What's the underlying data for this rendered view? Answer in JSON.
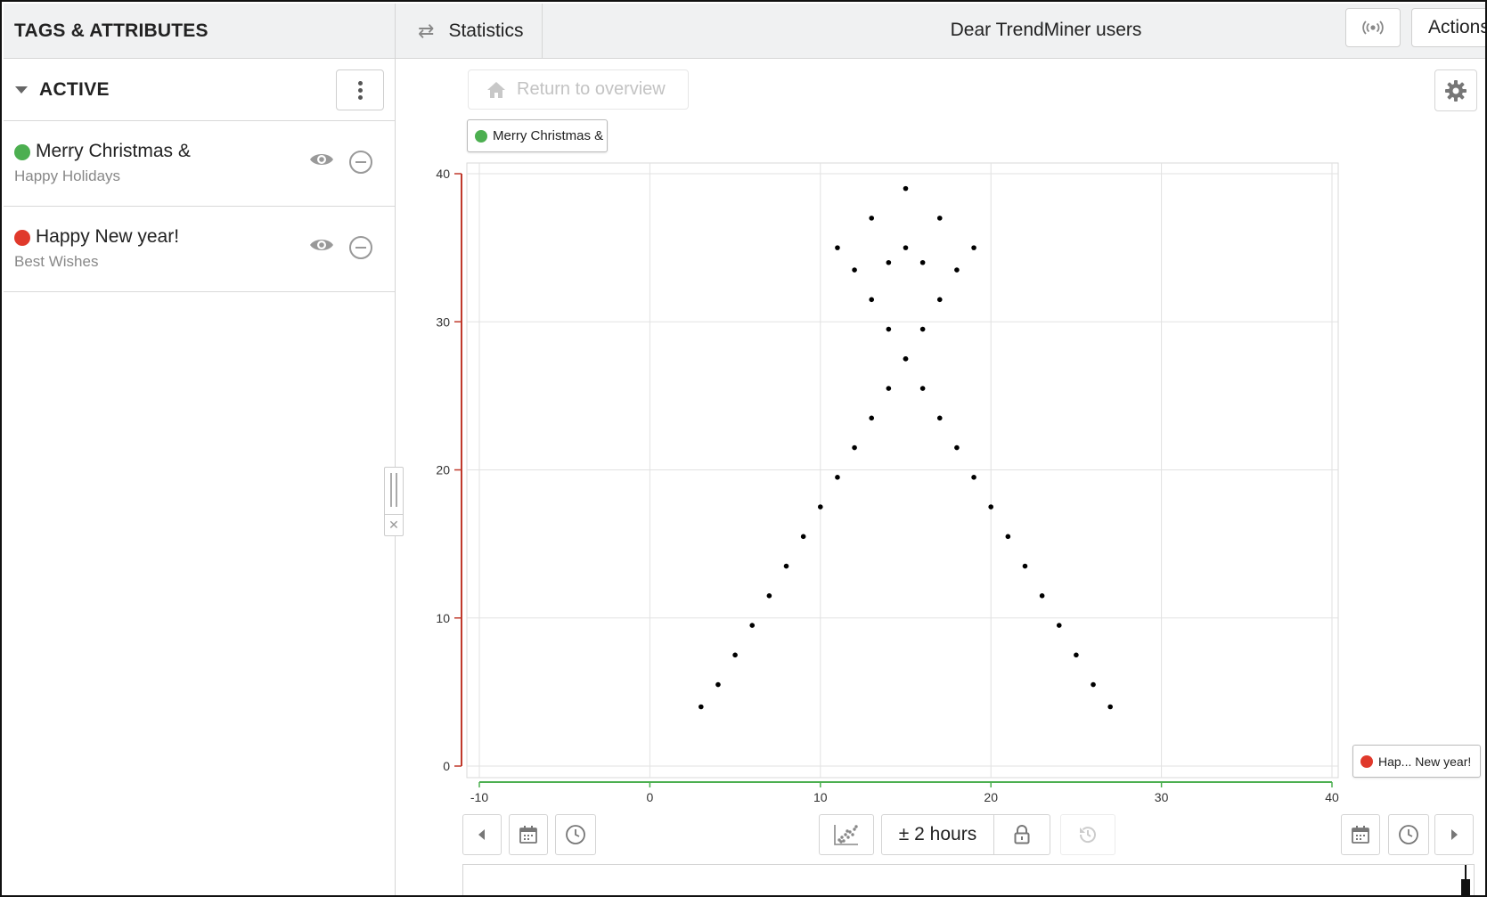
{
  "left_panel": {
    "title": "TAGS & ATTRIBUTES",
    "section_label": "ACTIVE",
    "tags": [
      {
        "name": "Merry Christmas &",
        "description": "Happy Holidays",
        "color": "#4caf50"
      },
      {
        "name": "Happy New year!",
        "description": "Best Wishes",
        "color": "#e0392b"
      }
    ]
  },
  "topbar": {
    "statistics_label": "Statistics",
    "view_title": "Dear TrendMiner users",
    "actions_label": "Actions"
  },
  "main": {
    "return_label": "Return to overview",
    "x_chip_label": "Merry Christmas &",
    "y_chip_label": "Hap... New year!"
  },
  "toolbar": {
    "range_label": "± 2 hours"
  },
  "colors": {
    "x_series": "#4caf50",
    "y_series": "#e0392b",
    "y_axis_line": "#c0392b",
    "x_axis_line": "#4caf50",
    "points": "#000000"
  },
  "icons": [
    "swap-icon",
    "broadcast-icon",
    "home-icon",
    "gear-icon",
    "more-vertical-icon",
    "eye-icon",
    "minus-circle-icon",
    "chevron-left-icon",
    "calendar-icon",
    "clock-icon",
    "scatter-icon",
    "lock-icon",
    "history-icon",
    "chevron-right-icon",
    "caret-down-icon"
  ],
  "chart_data": {
    "type": "scatter",
    "xlim": [
      -10,
      40
    ],
    "ylim": [
      0,
      40
    ],
    "x_ticks": [
      "-10",
      "0",
      "10",
      "20",
      "30",
      "40"
    ],
    "y_ticks": [
      "0",
      "10",
      "20",
      "30",
      "40"
    ],
    "grid": true,
    "point_color": "#000000",
    "series": [
      {
        "points": [
          [
            3,
            4
          ],
          [
            4,
            5.5
          ],
          [
            5,
            7.5
          ],
          [
            6,
            9.5
          ],
          [
            7,
            11.5
          ],
          [
            8,
            13.5
          ],
          [
            9,
            15.5
          ],
          [
            10,
            17.5
          ],
          [
            11,
            19.5
          ],
          [
            12,
            21.5
          ],
          [
            13,
            23.5
          ],
          [
            14,
            25.5
          ],
          [
            15,
            27.5
          ],
          [
            16,
            29.5
          ],
          [
            17,
            31.5
          ],
          [
            18,
            33.5
          ],
          [
            19,
            35
          ],
          [
            27,
            4
          ],
          [
            26,
            5.5
          ],
          [
            25,
            7.5
          ],
          [
            24,
            9.5
          ],
          [
            23,
            11.5
          ],
          [
            22,
            13.5
          ],
          [
            21,
            15.5
          ],
          [
            20,
            17.5
          ],
          [
            19,
            19.5
          ],
          [
            18,
            21.5
          ],
          [
            17,
            23.5
          ],
          [
            16,
            25.5
          ],
          [
            15,
            27.5
          ],
          [
            14,
            29.5
          ],
          [
            13,
            31.5
          ],
          [
            12,
            33.5
          ],
          [
            11,
            35
          ]
        ]
      },
      {
        "points": [
          [
            15,
            39
          ],
          [
            13,
            37
          ],
          [
            17,
            37
          ],
          [
            14,
            34
          ],
          [
            16,
            34
          ],
          [
            15,
            35
          ]
        ]
      }
    ]
  }
}
